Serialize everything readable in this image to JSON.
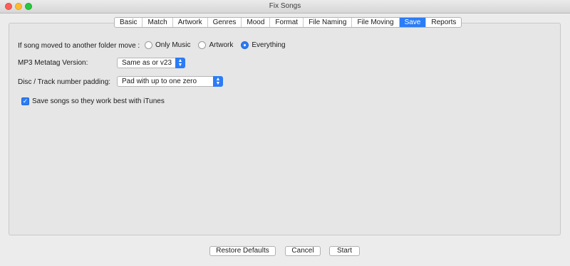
{
  "window": {
    "title": "Fix Songs"
  },
  "tabs": [
    {
      "label": "Basic"
    },
    {
      "label": "Match"
    },
    {
      "label": "Artwork"
    },
    {
      "label": "Genres"
    },
    {
      "label": "Mood"
    },
    {
      "label": "Format"
    },
    {
      "label": "File Naming"
    },
    {
      "label": "File Moving"
    },
    {
      "label": "Save",
      "active": true
    },
    {
      "label": "Reports"
    }
  ],
  "save": {
    "move_label": "If song moved to another folder move :",
    "move_options": [
      {
        "label": "Only Music",
        "selected": false
      },
      {
        "label": "Artwork",
        "selected": false
      },
      {
        "label": "Everything",
        "selected": true
      }
    ],
    "metatag_label": "MP3 Metatag Version:",
    "metatag_value": "Same as or v23",
    "padding_label": "Disc / Track number padding:",
    "padding_value": "Pad with up to one zero",
    "itunes_label": "Save songs so they work best with iTunes",
    "itunes_checked": true
  },
  "buttons": {
    "restore": "Restore Defaults",
    "cancel": "Cancel",
    "start": "Start"
  },
  "colors": {
    "accent": "#2b7cf6"
  }
}
